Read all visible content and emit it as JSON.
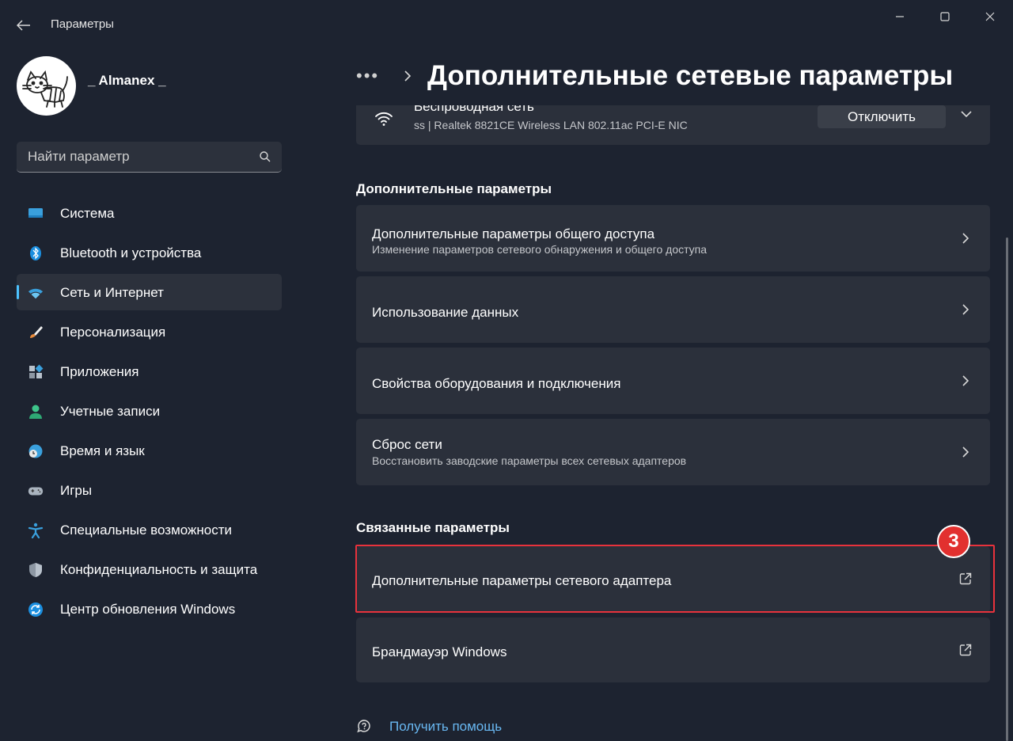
{
  "window": {
    "app_title": "Параметры",
    "controls": [
      "minimize-icon",
      "maximize-icon",
      "close-icon"
    ]
  },
  "profile": {
    "username": "_ Almanex _"
  },
  "search": {
    "placeholder": "Найти параметр"
  },
  "sidebar": {
    "items": [
      {
        "label": "Система",
        "icon": "system-icon"
      },
      {
        "label": "Bluetooth и устройства",
        "icon": "bluetooth-icon"
      },
      {
        "label": "Сеть и Интернет",
        "icon": "wifi-icon",
        "active": true
      },
      {
        "label": "Персонализация",
        "icon": "brush-icon"
      },
      {
        "label": "Приложения",
        "icon": "apps-icon"
      },
      {
        "label": "Учетные записи",
        "icon": "account-icon"
      },
      {
        "label": "Время и язык",
        "icon": "globe-clock-icon"
      },
      {
        "label": "Игры",
        "icon": "gamepad-icon"
      },
      {
        "label": "Специальные возможности",
        "icon": "accessibility-icon"
      },
      {
        "label": "Конфиденциальность и защита",
        "icon": "shield-icon"
      },
      {
        "label": "Центр обновления Windows",
        "icon": "update-icon"
      }
    ]
  },
  "header": {
    "breadcrumb_dots": "•••",
    "title": "Дополнительные сетевые параметры"
  },
  "adapter": {
    "name": "Беспроводная сеть",
    "details": "ss | Realtek 8821CE Wireless LAN 802.11ac PCI-E NIC",
    "disconnect_label": "Отключить"
  },
  "advanced": {
    "heading": "Дополнительные параметры",
    "items": [
      {
        "title": "Дополнительные параметры общего доступа",
        "subtitle": "Изменение параметров сетевого обнаружения и общего доступа"
      },
      {
        "title": "Использование данных"
      },
      {
        "title": "Свойства оборудования и подключения"
      },
      {
        "title": "Сброс сети",
        "subtitle": "Восстановить заводские параметры всех сетевых адаптеров"
      }
    ]
  },
  "related": {
    "heading": "Связанные параметры",
    "items": [
      {
        "title": "Дополнительные параметры сетевого адаптера",
        "icon": "external-link-icon"
      },
      {
        "title": "Брандмауэр Windows",
        "icon": "external-link-icon"
      }
    ]
  },
  "annotation": {
    "badge": "3",
    "color": "#e8323c"
  },
  "help": {
    "label": "Получить помощь"
  },
  "colors": {
    "background": "#1d2330",
    "card": "#2b303b",
    "accent": "#4cc2ff",
    "link": "#69b8f2"
  }
}
